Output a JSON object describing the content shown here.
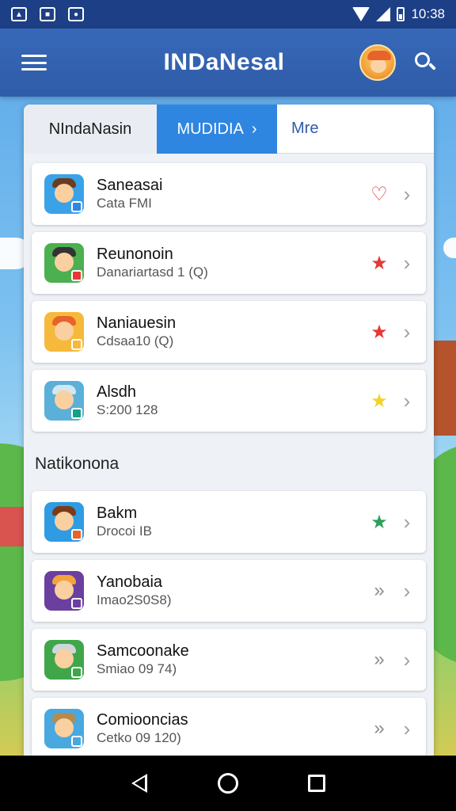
{
  "status_bar": {
    "time": "10:38",
    "left_icons": [
      "gallery-icon",
      "photo-icon",
      "notification-icon"
    ],
    "right_icons": [
      "wifi-icon",
      "signal-icon",
      "battery-icon"
    ]
  },
  "app_bar": {
    "title": "INDaNesal",
    "menu_icon": "hamburger-menu-icon",
    "avatar_icon": "user-avatar-icon",
    "search_icon": "search-icon"
  },
  "tabs": [
    {
      "label": "NIndaNasin",
      "active": false
    },
    {
      "label": "MUDIDIA",
      "active": true,
      "chevron": "›"
    },
    {
      "label": "Mre",
      "active": false
    }
  ],
  "list1": [
    {
      "title": "Saneasai",
      "subtitle": "Cata FMI",
      "mark": "♡",
      "mark_color": "#d9302b",
      "icon_bg": "#3aa3e8",
      "hat_color": "#6b3d1f",
      "badge_color": "#2f86e0"
    },
    {
      "title": "Reunonoin",
      "subtitle": "Danariartasd 1 (Q)",
      "mark": "★",
      "mark_color": "#e53935",
      "icon_bg": "#4caf50",
      "hat_color": "#333333",
      "badge_color": "#e53935"
    },
    {
      "title": "Naniauesin",
      "subtitle": "Cdsaa10 (Q)",
      "mark": "★",
      "mark_color": "#e53935",
      "icon_bg": "#f6b93b",
      "hat_color": "#e8632a",
      "badge_color": "#f6b93b"
    },
    {
      "title": "Alsdh",
      "subtitle": "S:200 128",
      "mark": "★",
      "mark_color": "#f2d12a",
      "icon_bg": "#5ab0d8",
      "hat_color": "#d6e6ee",
      "badge_color": "#16a085"
    }
  ],
  "section_heading": "Natikonona",
  "list2": [
    {
      "title": "Bakm",
      "subtitle": "Drocoi IB",
      "mark": "★",
      "mark_color": "#2e9e5b",
      "icon_bg": "#2f9be3",
      "hat_color": "#7b3b17",
      "badge_color": "#e8632a"
    },
    {
      "title": "Yanobaia",
      "subtitle": "Imao2S0S8)",
      "mark": "»",
      "mark_color": "#8a8f96",
      "icon_bg": "#6a3fa0",
      "hat_color": "#f2a33a",
      "badge_color": "#6a3fa0"
    },
    {
      "title": "Samcoonake",
      "subtitle": "Smiao 09 74)",
      "mark": "»",
      "mark_color": "#8a8f96",
      "icon_bg": "#3fa64a",
      "hat_color": "#cfd6d8",
      "badge_color": "#3fa64a"
    },
    {
      "title": "Comiooncias",
      "subtitle": "Cetko 09 120)",
      "mark": "»",
      "mark_color": "#8a8f96",
      "icon_bg": "#4aa8e0",
      "hat_color": "#b88a4a",
      "badge_color": "#4aa8e0"
    }
  ],
  "chevron": "›",
  "nav_bar": {
    "back_icon": "back-icon",
    "home_icon": "home-icon",
    "recents_icon": "recents-icon"
  }
}
